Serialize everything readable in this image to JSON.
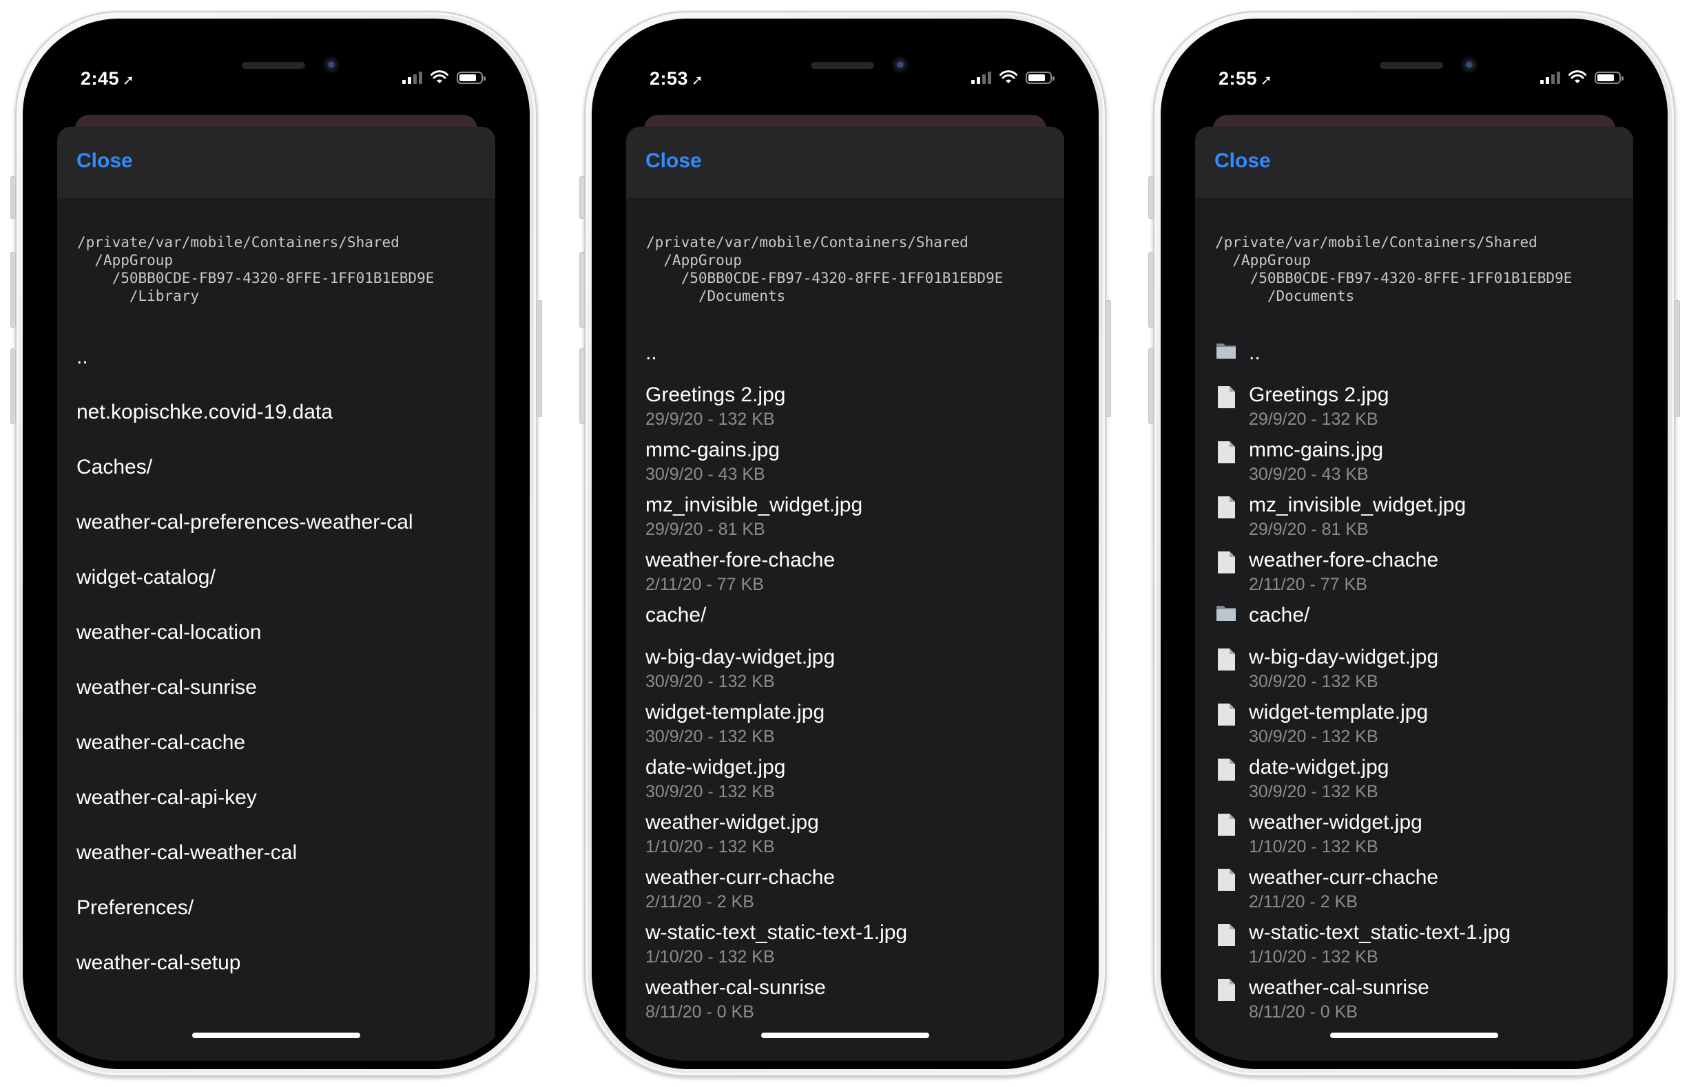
{
  "phones": [
    {
      "time": "2:45",
      "close_label": "Close",
      "path_lines": [
        "/private/var/mobile/Containers/Shared",
        "  /AppGroup",
        "    /50BB0CDE-FB97-4320-8FFE-1FF01B1EBD9E",
        "      /Library"
      ],
      "entries": [
        {
          "name": ".."
        },
        {
          "name": "net.kopischke.covid-19.data"
        },
        {
          "name": "Caches/"
        },
        {
          "name": "weather-cal-preferences-weather-cal"
        },
        {
          "name": "widget-catalog/"
        },
        {
          "name": "weather-cal-location"
        },
        {
          "name": "weather-cal-sunrise"
        },
        {
          "name": "weather-cal-cache"
        },
        {
          "name": "weather-cal-api-key"
        },
        {
          "name": "weather-cal-weather-cal"
        },
        {
          "name": "Preferences/"
        },
        {
          "name": "weather-cal-setup"
        }
      ]
    },
    {
      "time": "2:53",
      "close_label": "Close",
      "path_lines": [
        "/private/var/mobile/Containers/Shared",
        "  /AppGroup",
        "    /50BB0CDE-FB97-4320-8FFE-1FF01B1EBD9E",
        "      /Documents"
      ],
      "entries": [
        {
          "name": "..",
          "icon": "none",
          "kind": "dir"
        },
        {
          "name": "Greetings 2.jpg",
          "meta": "29/9/20 - 132 KB",
          "icon": "none",
          "kind": "file"
        },
        {
          "name": "mmc-gains.jpg",
          "meta": "30/9/20 - 43 KB",
          "icon": "none",
          "kind": "file"
        },
        {
          "name": "mz_invisible_widget.jpg",
          "meta": "29/9/20 - 81 KB",
          "icon": "none",
          "kind": "file"
        },
        {
          "name": "weather-fore-chache",
          "meta": "2/11/20 - 77 KB",
          "icon": "none",
          "kind": "file"
        },
        {
          "name": "cache/",
          "icon": "none",
          "kind": "dir"
        },
        {
          "name": "w-big-day-widget.jpg",
          "meta": "30/9/20 - 132 KB",
          "icon": "none",
          "kind": "file"
        },
        {
          "name": "widget-template.jpg",
          "meta": "30/9/20 - 132 KB",
          "icon": "none",
          "kind": "file"
        },
        {
          "name": "date-widget.jpg",
          "meta": "30/9/20 - 132 KB",
          "icon": "none",
          "kind": "file"
        },
        {
          "name": "weather-widget.jpg",
          "meta": "1/10/20 - 132 KB",
          "icon": "none",
          "kind": "file"
        },
        {
          "name": "weather-curr-chache",
          "meta": "2/11/20 - 2 KB",
          "icon": "none",
          "kind": "file"
        },
        {
          "name": "w-static-text_static-text-1.jpg",
          "meta": "1/10/20 - 132 KB",
          "icon": "none",
          "kind": "file"
        },
        {
          "name": "weather-cal-sunrise",
          "meta": "8/11/20 - 0 KB",
          "icon": "none",
          "kind": "file"
        }
      ]
    },
    {
      "time": "2:55",
      "close_label": "Close",
      "path_lines": [
        "/private/var/mobile/Containers/Shared",
        "  /AppGroup",
        "    /50BB0CDE-FB97-4320-8FFE-1FF01B1EBD9E",
        "      /Documents"
      ],
      "entries": [
        {
          "name": "..",
          "icon": "folder-icon",
          "kind": "dir"
        },
        {
          "name": "Greetings 2.jpg",
          "meta": "29/9/20 - 132 KB",
          "icon": "file-icon",
          "kind": "file"
        },
        {
          "name": "mmc-gains.jpg",
          "meta": "30/9/20 - 43 KB",
          "icon": "file-icon",
          "kind": "file"
        },
        {
          "name": "mz_invisible_widget.jpg",
          "meta": "29/9/20 - 81 KB",
          "icon": "file-icon",
          "kind": "file"
        },
        {
          "name": "weather-fore-chache",
          "meta": "2/11/20 - 77 KB",
          "icon": "file-icon",
          "kind": "file"
        },
        {
          "name": "cache/",
          "icon": "folder-icon",
          "kind": "dir"
        },
        {
          "name": "w-big-day-widget.jpg",
          "meta": "30/9/20 - 132 KB",
          "icon": "file-icon",
          "kind": "file"
        },
        {
          "name": "widget-template.jpg",
          "meta": "30/9/20 - 132 KB",
          "icon": "file-icon",
          "kind": "file"
        },
        {
          "name": "date-widget.jpg",
          "meta": "30/9/20 - 132 KB",
          "icon": "file-icon",
          "kind": "file"
        },
        {
          "name": "weather-widget.jpg",
          "meta": "1/10/20 - 132 KB",
          "icon": "file-icon",
          "kind": "file"
        },
        {
          "name": "weather-curr-chache",
          "meta": "2/11/20 - 2 KB",
          "icon": "file-icon",
          "kind": "file"
        },
        {
          "name": "w-static-text_static-text-1.jpg",
          "meta": "1/10/20 - 132 KB",
          "icon": "file-icon",
          "kind": "file"
        },
        {
          "name": "weather-cal-sunrise",
          "meta": "8/11/20 - 0 KB",
          "icon": "file-icon",
          "kind": "file"
        }
      ]
    }
  ],
  "colors": {
    "accent": "#2f8cff",
    "sheet_bg": "#1c1c1e",
    "nav_bg": "#262629",
    "meta_text": "#8c8c90"
  }
}
